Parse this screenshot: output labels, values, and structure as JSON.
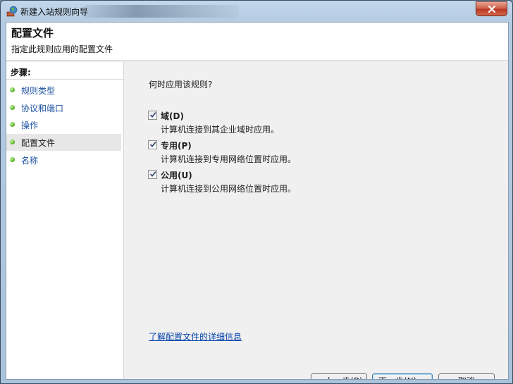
{
  "window": {
    "title": "新建入站规则向导",
    "close_glyph": "✕"
  },
  "header": {
    "title": "配置文件",
    "subtitle": "指定此规则应用的配置文件"
  },
  "steps": {
    "title": "步骤:",
    "items": [
      {
        "label": "规则类型",
        "current": false
      },
      {
        "label": "协议和端口",
        "current": false
      },
      {
        "label": "操作",
        "current": false
      },
      {
        "label": "配置文件",
        "current": true
      },
      {
        "label": "名称",
        "current": false
      }
    ]
  },
  "content": {
    "question": "何时应用该规则?",
    "options": [
      {
        "label": "域(D)",
        "description": "计算机连接到其企业域时应用。",
        "checked": true
      },
      {
        "label": "专用(P)",
        "description": "计算机连接到专用网络位置时应用。",
        "checked": true
      },
      {
        "label": "公用(U)",
        "description": "计算机连接到公用网络位置时应用。",
        "checked": true
      }
    ],
    "learn_more": "了解配置文件的详细信息"
  },
  "buttons": {
    "back": "< 上一步(B)",
    "next": "下一步(N) >",
    "cancel": "取消"
  },
  "colors": {
    "link": "#0645ad",
    "step_link": "#1a4fa0",
    "close_red": "#c0432c",
    "step_dot": "#4dac1e"
  }
}
